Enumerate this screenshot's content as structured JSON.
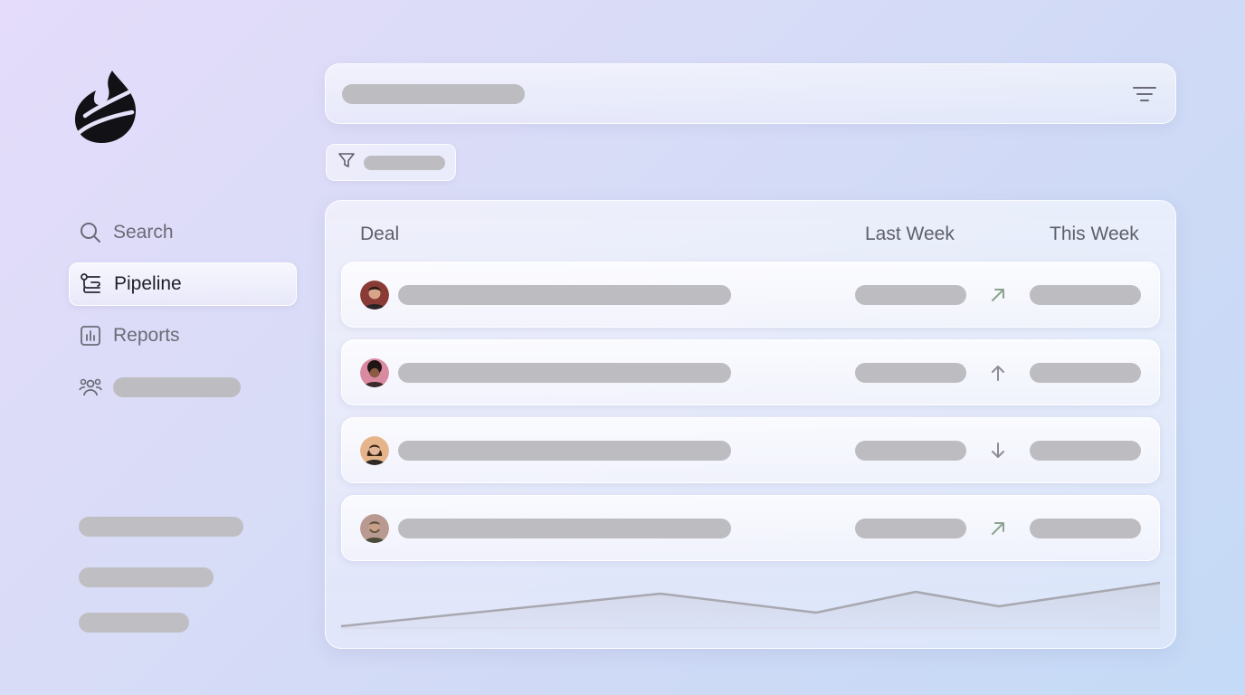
{
  "app": {
    "logo_icon": "flame-logo-icon"
  },
  "sidebar": {
    "items": [
      {
        "label": "Search",
        "icon": "search-icon",
        "active": false
      },
      {
        "label": "Pipeline",
        "icon": "pipeline-icon",
        "active": true
      },
      {
        "label": "Reports",
        "icon": "reports-icon",
        "active": false
      },
      {
        "label": "",
        "icon": "team-icon",
        "active": false
      }
    ]
  },
  "topbar": {
    "icon": "filter-lines-icon"
  },
  "filter_chip": {
    "icon": "funnel-icon"
  },
  "table": {
    "headers": {
      "deal": "Deal",
      "last_week": "Last Week",
      "this_week": "This Week"
    },
    "rows": [
      {
        "avatar": "avatar-1",
        "trend": "up-right"
      },
      {
        "avatar": "avatar-2",
        "trend": "up"
      },
      {
        "avatar": "avatar-3",
        "trend": "down"
      },
      {
        "avatar": "avatar-4",
        "trend": "up-right"
      }
    ]
  },
  "colors": {
    "placeholder": "#bdbdc1",
    "trend_up": "#8aa38c",
    "trend_down": "#8c8c96",
    "sparkline": "#a8a8b0"
  }
}
